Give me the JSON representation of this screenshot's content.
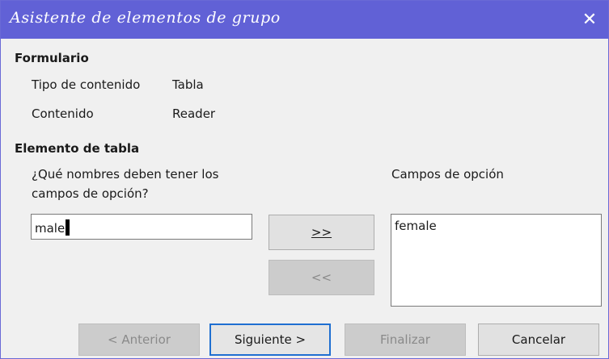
{
  "window": {
    "title": "Asistente de elementos de grupo",
    "close_glyph": "✕"
  },
  "form_section": {
    "heading": "Formulario",
    "content_type_label": "Tipo de contenido",
    "content_type_value": "Tabla",
    "content_label": "Contenido",
    "content_value": "Reader"
  },
  "table_section": {
    "heading": "Elemento de tabla",
    "names_label_line1": "¿Qué nombres deben tener los",
    "names_label_line2": "campos de opción?",
    "name_input_value": "male",
    "option_fields_label": "Campos de opción",
    "option_fields": [
      "female"
    ]
  },
  "transfer_buttons": {
    "add": ">>",
    "remove": "<<"
  },
  "footer": {
    "back": "< Anterior",
    "next": "Siguiente >",
    "finish": "Finalizar",
    "cancel": "Cancelar"
  },
  "colors": {
    "titlebar": "#6161d6",
    "default_button_border": "#1f6fd1"
  },
  "icons": {
    "close": "close-icon"
  }
}
